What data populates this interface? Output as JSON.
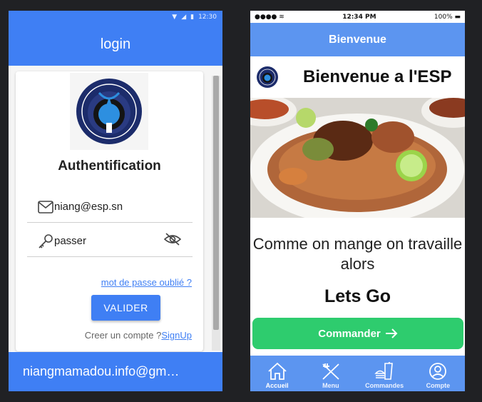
{
  "login_screen": {
    "status_bar": {
      "time": "12:30"
    },
    "app_bar_title": "login",
    "card_title": "Authentification",
    "email_value": "niang@esp.sn",
    "password_value": "passer",
    "forgot_link": "mot de passe oublié ?",
    "validate_button": "VALIDER",
    "signup_prompt": "Creer un compte ?",
    "signup_link": "SignUp",
    "footer_text": "niangmamadou.info@gm…",
    "accent_color": "#3f7ff4"
  },
  "welcome_screen": {
    "status_bar": {
      "time": "12:34 PM",
      "battery": "100%"
    },
    "nav_title": "Bienvenue",
    "header_title": "Bienvenue a l'ESP",
    "tagline": "Comme on mange on travaille alors",
    "lets_go": "Lets Go",
    "order_button": "Commander",
    "tabs": [
      {
        "label": "Accueil",
        "icon": "home-icon",
        "active": true
      },
      {
        "label": "Menu",
        "icon": "utensils-icon",
        "active": false
      },
      {
        "label": "Commandes",
        "icon": "fastfood-icon",
        "active": false
      },
      {
        "label": "Compte",
        "icon": "user-circle-icon",
        "active": false
      }
    ],
    "accent_color": "#5c95f0",
    "button_color": "#2ecc6e"
  }
}
